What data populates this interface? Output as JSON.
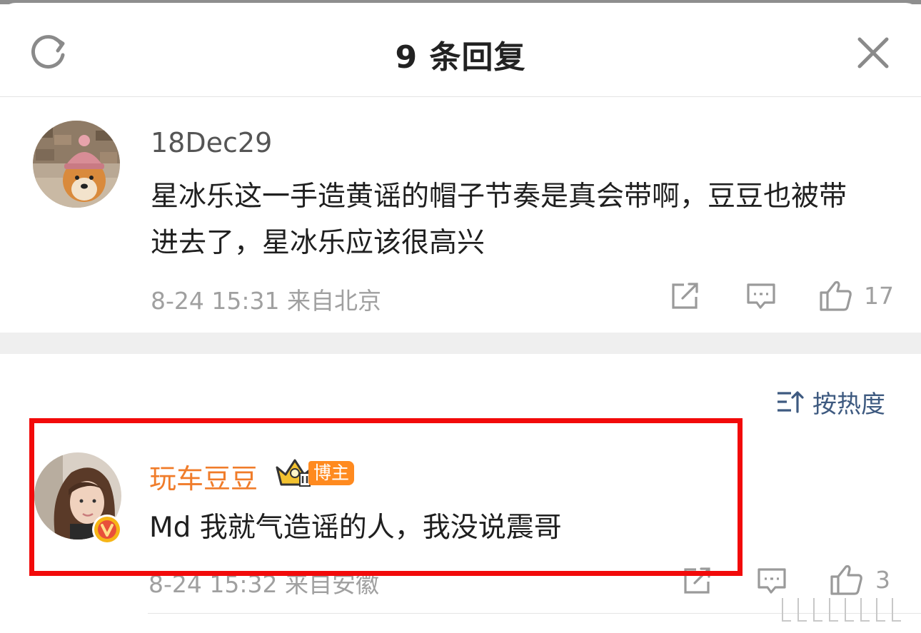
{
  "header": {
    "title": "9 条回复",
    "refresh_icon": "refresh-icon",
    "close_icon": "close-icon"
  },
  "root_comment": {
    "username": "18Dec29",
    "text": "星冰乐这一手造黄谣的帽子节奏是真会带啊，豆豆也被带进去了，星冰乐应该很高兴",
    "timestamp": "8-24 15:31 来自北京",
    "like_count": "17",
    "actions": [
      "share-icon",
      "comment-icon",
      "like-icon"
    ]
  },
  "sort": {
    "label": "按热度",
    "icon": "sort-icon"
  },
  "reply_comment": {
    "username": "玩车豆豆",
    "badge_label": "博主",
    "verified_icon": "verified-v-icon",
    "crown_icon": "crown-level-icon",
    "text": "Md 我就气造谣的人，我没说震哥",
    "timestamp": "8-24 15:32 来自安徽",
    "like_count": "3",
    "actions": [
      "share-icon",
      "comment-icon",
      "like-icon"
    ]
  },
  "colors": {
    "username_host": "#f07c2a",
    "badge_bg": "#ff8a1f",
    "sort_text": "#3e5a80",
    "highlight_box": "#f20a0a",
    "meta_text": "#a0a0a0"
  }
}
